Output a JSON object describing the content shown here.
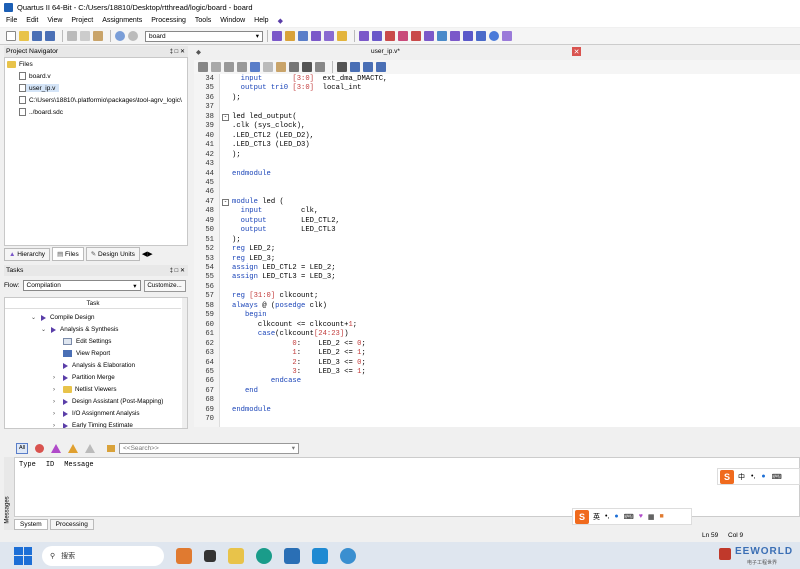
{
  "window": {
    "title": "Quartus II 64-Bit - C:/Users/18810/Desktop/rtthread/logic/board - board"
  },
  "menu": [
    "File",
    "Edit",
    "View",
    "Project",
    "Assignments",
    "Processing",
    "Tools",
    "Window",
    "Help"
  ],
  "toolbar": {
    "project_select": "board"
  },
  "project_navigator": {
    "title": "Project Navigator",
    "root": "Files",
    "files": [
      "board.v",
      "user_ip.v",
      "C:\\Users\\18810\\.platformio\\packages\\tool-agrv_logic\\",
      "../board.sdc"
    ],
    "tabs": [
      "Hierarchy",
      "Files",
      "Design Units"
    ]
  },
  "tasks": {
    "title": "Tasks",
    "flow_label": "Flow:",
    "flow_value": "Compilation",
    "customize_label": "Customize...",
    "column_header": "Task",
    "items": [
      "Compile Design",
      "Analysis & Synthesis",
      "Edit Settings",
      "View Report",
      "Analysis & Elaboration",
      "Partition Merge",
      "Netlist Viewers",
      "Design Assistant (Post-Mapping)",
      "I/O Assignment Analysis",
      "Early Timing Estimate"
    ]
  },
  "editor": {
    "tab_label": "user_ip.v*",
    "line_numbers": [
      "34",
      "35",
      "36",
      "37",
      "38",
      "39",
      "40",
      "41",
      "42",
      "43",
      "44",
      "45",
      "46",
      "47",
      "48",
      "49",
      "50",
      "51",
      "52",
      "53",
      "54",
      "55",
      "56",
      "57",
      "58",
      "59",
      "60",
      "61",
      "62",
      "63",
      "64",
      "65",
      "66",
      "67",
      "68",
      "69",
      "70"
    ],
    "lines": [
      [
        {
          "t": "  "
        },
        {
          "k": "input"
        },
        {
          "t": "       "
        },
        {
          "n": "[3:0]"
        },
        {
          "t": "  ext_dma_DMACTC,"
        }
      ],
      [
        {
          "t": "  "
        },
        {
          "k": "output tri0"
        },
        {
          "t": " "
        },
        {
          "n": "[3:0]"
        },
        {
          "t": "  local_int"
        }
      ],
      [
        {
          "t": ");"
        }
      ],
      [
        {
          "t": ""
        }
      ],
      [
        {
          "t": "led led_output("
        }
      ],
      [
        {
          "t": ".clk (sys_clock),"
        }
      ],
      [
        {
          "t": ".LED_CTL2 (LED_D2),"
        }
      ],
      [
        {
          "t": ".LED_CTL3 (LED_D3)"
        }
      ],
      [
        {
          "t": ");"
        }
      ],
      [
        {
          "t": ""
        }
      ],
      [
        {
          "k": "endmodule"
        }
      ],
      [
        {
          "t": ""
        }
      ],
      [
        {
          "t": ""
        }
      ],
      [
        {
          "k": "module"
        },
        {
          "t": " led ("
        }
      ],
      [
        {
          "t": "  "
        },
        {
          "k": "input"
        },
        {
          "t": "         clk,"
        }
      ],
      [
        {
          "t": "  "
        },
        {
          "k": "output"
        },
        {
          "t": "        LED_CTL2,"
        }
      ],
      [
        {
          "t": "  "
        },
        {
          "k": "output"
        },
        {
          "t": "        LED_CTL3"
        }
      ],
      [
        {
          "t": ");"
        }
      ],
      [
        {
          "k": "reg"
        },
        {
          "t": " LED_2;"
        }
      ],
      [
        {
          "k": "reg"
        },
        {
          "t": " LED_3;"
        }
      ],
      [
        {
          "k": "assign"
        },
        {
          "t": " LED_CTL2 = LED_2;"
        }
      ],
      [
        {
          "k": "assign"
        },
        {
          "t": " LED_CTL3 = LED_3;"
        }
      ],
      [
        {
          "t": ""
        }
      ],
      [
        {
          "k": "reg"
        },
        {
          "t": " "
        },
        {
          "n": "[31:0]"
        },
        {
          "t": " clkcount;"
        }
      ],
      [
        {
          "k": "always"
        },
        {
          "t": " @ ("
        },
        {
          "k": "posedge"
        },
        {
          "t": " clk)"
        }
      ],
      [
        {
          "t": "   "
        },
        {
          "k": "begin"
        }
      ],
      [
        {
          "t": "      clkcount <= clkcount+"
        },
        {
          "n": "1"
        },
        {
          "t": ";"
        }
      ],
      [
        {
          "t": "      "
        },
        {
          "k": "case"
        },
        {
          "t": "(clkcount"
        },
        {
          "n": "[24:23]"
        },
        {
          "t": ")"
        }
      ],
      [
        {
          "t": "              "
        },
        {
          "n": "0"
        },
        {
          "t": ":    LED_2 <= "
        },
        {
          "n": "0"
        },
        {
          "t": ";"
        }
      ],
      [
        {
          "t": "              "
        },
        {
          "n": "1"
        },
        {
          "t": ":    LED_2 <= "
        },
        {
          "n": "1"
        },
        {
          "t": ";"
        }
      ],
      [
        {
          "t": "              "
        },
        {
          "n": "2"
        },
        {
          "t": ":    LED_3 <= "
        },
        {
          "n": "0"
        },
        {
          "t": ";"
        }
      ],
      [
        {
          "t": "              "
        },
        {
          "n": "3"
        },
        {
          "t": ":    LED_3 <= "
        },
        {
          "n": "1"
        },
        {
          "t": ";"
        }
      ],
      [
        {
          "t": "         "
        },
        {
          "k": "endcase"
        }
      ],
      [
        {
          "t": "   "
        },
        {
          "k": "end"
        }
      ],
      [
        {
          "t": ""
        }
      ],
      [
        {
          "k": "endmodule"
        }
      ],
      [
        {
          "t": ""
        }
      ]
    ]
  },
  "messages": {
    "filter_all": "All",
    "search_placeholder": "<<Search>>",
    "columns": [
      "Type",
      "ID",
      "Message"
    ],
    "side_label": "Messages",
    "tabs": [
      "System",
      "Processing"
    ]
  },
  "statusbar": {
    "ln": "Ln 59",
    "col": "Col 9"
  },
  "taskbar": {
    "search": "搜索"
  },
  "ime": {
    "lang": "中",
    "lang2": "英"
  },
  "watermark": {
    "brand": "EEWORLD",
    "sub": "电子工程世界"
  },
  "colors": {
    "keyword": "#1a44b8",
    "number": "#c23a3a",
    "accent": "#1c5fb5"
  }
}
